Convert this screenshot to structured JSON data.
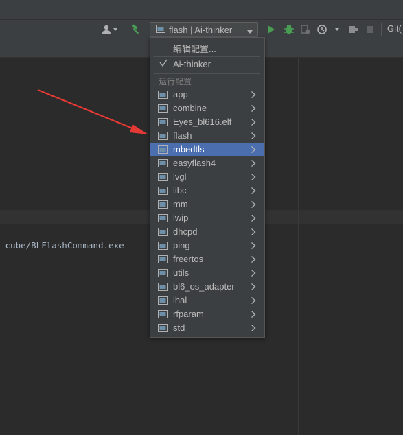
{
  "toolbar": {
    "run_config_label": "flash | Ai-thinker",
    "git_label": "Git("
  },
  "editor": {
    "code_line": "_cube/BLFlashCommand.exe"
  },
  "popup": {
    "edit_configurations": "编辑配置...",
    "active_target": "Ai-thinker",
    "section_title": "运行配置",
    "items": [
      {
        "label": "app"
      },
      {
        "label": "combine"
      },
      {
        "label": "Eyes_bl616.elf"
      },
      {
        "label": "flash"
      },
      {
        "label": "mbedtls",
        "selected": true
      },
      {
        "label": "easyflash4"
      },
      {
        "label": "lvgl"
      },
      {
        "label": "libc"
      },
      {
        "label": "mm"
      },
      {
        "label": "lwip"
      },
      {
        "label": "dhcpd"
      },
      {
        "label": "ping"
      },
      {
        "label": "freertos"
      },
      {
        "label": "utils"
      },
      {
        "label": "bl6_os_adapter"
      },
      {
        "label": "lhal"
      },
      {
        "label": "rfparam"
      },
      {
        "label": "std"
      }
    ]
  },
  "colors": {
    "selection": "#4b6eaf",
    "run_green": "#499c54",
    "arrow_red": "#e53935"
  }
}
